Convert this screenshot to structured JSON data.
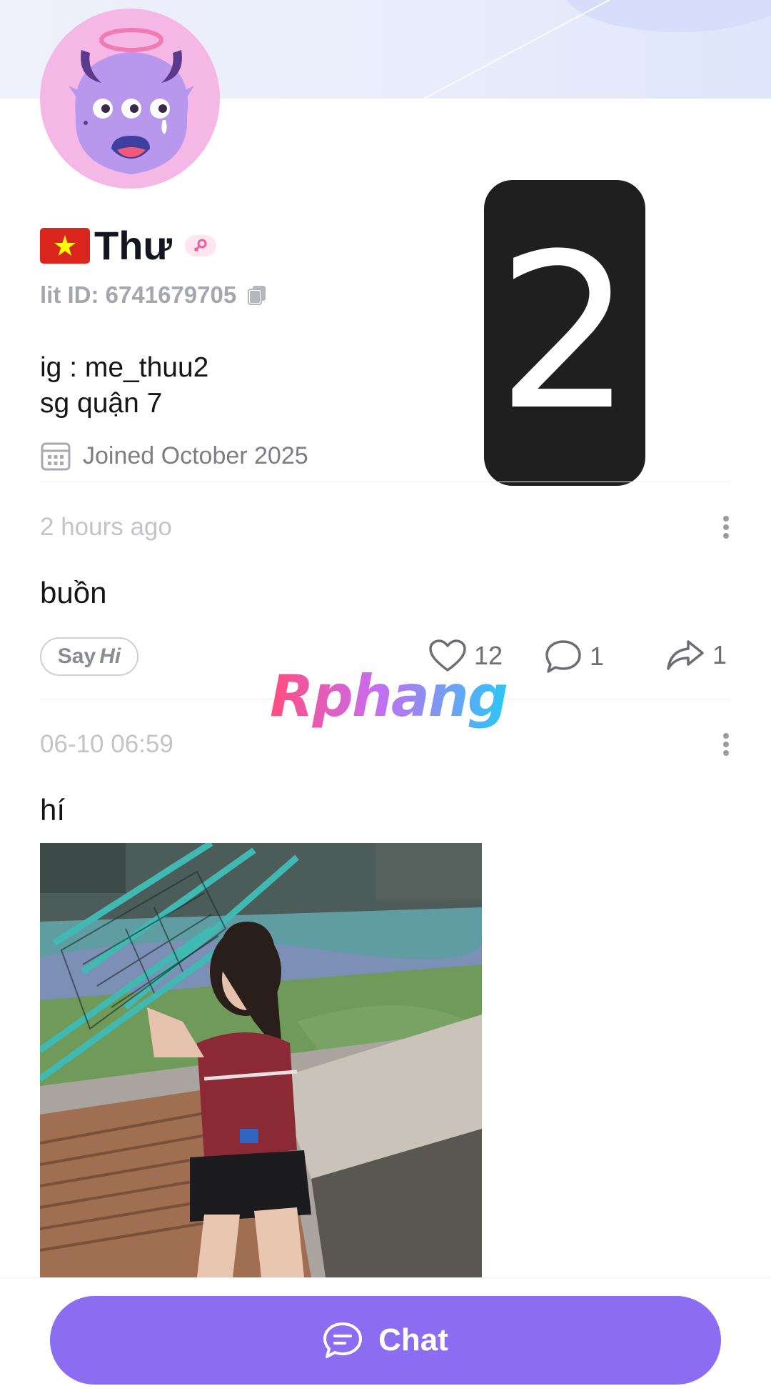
{
  "profile": {
    "name": "Thư",
    "lit_id": "lit ID: 6741679705",
    "bio_lines": [
      "ig : me_thuu2",
      "sg quận 7"
    ],
    "joined": "Joined October 2025",
    "badge_number": "2"
  },
  "posts": [
    {
      "time": "2 hours ago",
      "text": "buồn",
      "say_hi_parts": [
        "Say",
        "Hi"
      ],
      "likes": "12",
      "comments": "1",
      "shares": "1"
    },
    {
      "time": "06-10 06:59",
      "text": "hí"
    }
  ],
  "watermark": "Rphang",
  "chat_button": {
    "label": "Chat"
  },
  "colors": {
    "accent": "#8c6cf0",
    "avatar_bg": "#f5b8e6",
    "flag_red": "#da251d",
    "flag_star": "#ffff00"
  },
  "icons": {
    "avatar": "purple-monster-avatar",
    "flag": "vietnam-flag-icon",
    "gender": "female-icon",
    "copy": "copy-icon",
    "calendar": "calendar-icon",
    "more": "more-vertical-icon",
    "like": "heart-icon",
    "comment": "comment-icon",
    "share": "share-icon",
    "chat": "chat-bubble-icon"
  }
}
